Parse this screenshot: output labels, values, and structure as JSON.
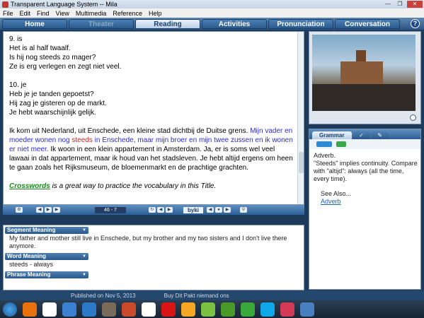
{
  "window": {
    "title": "Transparent Language System -- Mila"
  },
  "menu": [
    "File",
    "Edit",
    "Find",
    "View",
    "Multimedia",
    "Reference",
    "Help"
  ],
  "tabs": [
    {
      "label": "Home",
      "state": "normal"
    },
    {
      "label": "Theater",
      "state": "disabled"
    },
    {
      "label": "Reading",
      "state": "active"
    },
    {
      "label": "Activities",
      "state": "normal"
    },
    {
      "label": "Pronunciation",
      "state": "normal"
    },
    {
      "label": "Conversation",
      "state": "normal"
    }
  ],
  "help_label": "?",
  "reading": {
    "blocks": [
      [
        "9. is",
        "Het is al half twaalf.",
        "Is hij nog steeds zo mager?",
        "Ze is erg verlegen en zegt niet veel."
      ],
      [
        "10. je",
        "Heb je je tanden gepoetst?",
        "Hij zag je gisteren op de markt.",
        "Je hebt waarschijnlijk gelijk."
      ]
    ],
    "para_start": "Ik kom uit Nederland, uit Enschede, een kleine stad dichtbij de Duitse grens.",
    "para_blue1": "Mijn vader en moeder wonen nog",
    "para_red": "steeds",
    "para_blue2": "in Enschede, maar mijn broer en mijn twee zussen en ik wonen er niet meer.",
    "para_end": "Ik woon in een klein appartement in Amsterdam. Ja, er is soms wel veel lawaai in dat appartement, maar ik houd van het stadsleven. Je hebt altijd ergens om heen te gaan zoals het Rijksmuseum, de bloemenmarkt en de prachtige grachten.",
    "crosswords_link": "Crosswords",
    "crosswords_tail": "is a great way to practice the vocabulary in this Title."
  },
  "player": {
    "counter": "46 - 7",
    "byki": "byki"
  },
  "meaning": {
    "segment_head": "Segment Meaning",
    "segment_text": "My father and mother still live in Enschede, but my brother and my two sisters and I don't live there anymore.",
    "word_head": "Word Meaning",
    "word_text": "steeds - always",
    "phrase_head": "Phrase Meaning"
  },
  "grammar": {
    "tab_label": "Grammar",
    "title": "Adverb.",
    "body": "\"Steeds\" implies continuity. Compare with \"altijd\": always (all the time, every time).",
    "see_also": "See Also...",
    "link": "Adverb"
  },
  "strip": {
    "left": "Published on Nov 5, 2013",
    "right": "Buy   Dit Pakt niemand ons"
  }
}
